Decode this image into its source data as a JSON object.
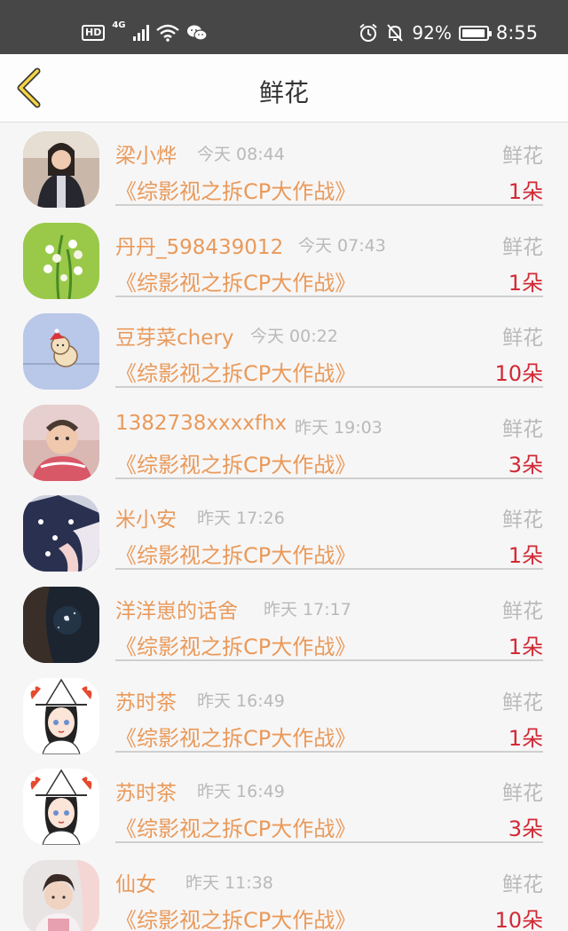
{
  "status_bar": {
    "hd_label": "HD",
    "network_label": "4G",
    "battery_percent": "92%",
    "time": "8:55"
  },
  "header": {
    "title": "鲜花",
    "back_icon": "chevron-left-icon"
  },
  "colors": {
    "status_bar_bg": "#474747",
    "accent_orange": "#e99a5a",
    "count_red": "#d02a35",
    "muted_gray": "#b9b9b9",
    "back_yellow": "#f5d642"
  },
  "items": [
    {
      "name": "梁小烨",
      "time": "今天 08:44",
      "gift_type": "鲜花",
      "work": "《综影视之拆CP大作战》",
      "count": "1朵"
    },
    {
      "name": "丹丹_598439012",
      "time": "今天 07:43",
      "gift_type": "鲜花",
      "work": "《综影视之拆CP大作战》",
      "count": "1朵"
    },
    {
      "name": "豆芽菜chery",
      "time": "今天 00:22",
      "gift_type": "鲜花",
      "work": "《综影视之拆CP大作战》",
      "count": "10朵"
    },
    {
      "name": "1382738xxxxfhx",
      "time": "昨天 19:03",
      "gift_type": "鲜花",
      "work": "《综影视之拆CP大作战》",
      "count": "3朵"
    },
    {
      "name": "米小安",
      "time": "昨天 17:26",
      "gift_type": "鲜花",
      "work": "《综影视之拆CP大作战》",
      "count": "1朵"
    },
    {
      "name": "洋洋崽的话舍",
      "time": "昨天 17:17",
      "gift_type": "鲜花",
      "work": "《综影视之拆CP大作战》",
      "count": "1朵"
    },
    {
      "name": "苏时茶",
      "time": "昨天 16:49",
      "gift_type": "鲜花",
      "work": "《综影视之拆CP大作战》",
      "count": "1朵"
    },
    {
      "name": "苏时茶",
      "time": "昨天 16:49",
      "gift_type": "鲜花",
      "work": "《综影视之拆CP大作战》",
      "count": "3朵"
    },
    {
      "name": "仙女",
      "time": "昨天 11:38",
      "gift_type": "鲜花",
      "work": "《综影视之拆CP大作战》",
      "count": "10朵"
    }
  ]
}
